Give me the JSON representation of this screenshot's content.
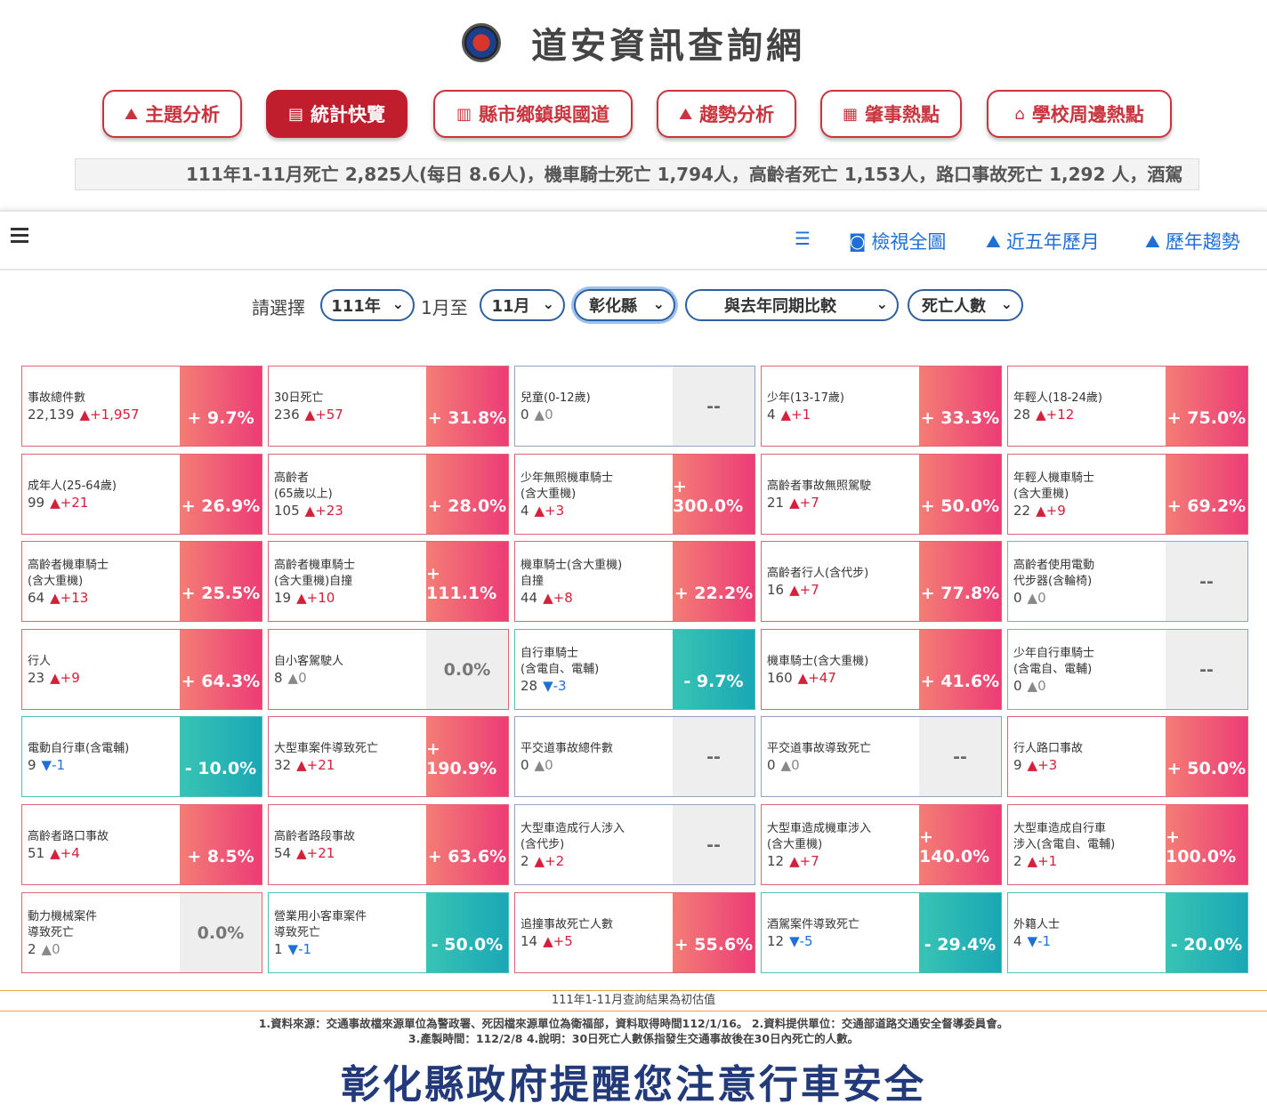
{
  "site": {
    "title": "道安資訊查詢網"
  },
  "nav": [
    {
      "label": "主題分析",
      "icon": "chart-area-icon",
      "glyph": "⛰",
      "active": false
    },
    {
      "label": "統計快覽",
      "icon": "newspaper-icon",
      "glyph": "▤",
      "active": true
    },
    {
      "label": "縣市鄉鎮與國道",
      "icon": "bar-chart-icon",
      "glyph": "▥",
      "active": false
    },
    {
      "label": "趨勢分析",
      "icon": "chart-area-icon",
      "glyph": "⛰",
      "active": false
    },
    {
      "label": "肇事熱點",
      "icon": "map-icon",
      "glyph": "▦",
      "active": false
    },
    {
      "label": "學校周邊熱點",
      "icon": "school-icon",
      "glyph": "⌂",
      "active": false
    }
  ],
  "ticker": "111年1-11月死亡 2,825人(每日 8.6人)，機車騎士死亡 1,794人，高齡者死亡 1,153人，路口事故死亡 1,292 人，酒駕",
  "toolbar": {
    "view_all": "檢視全圖",
    "five_year": "近五年歷月",
    "yearly_trend": "歷年趨勢"
  },
  "filters": {
    "prompt": "請選擇",
    "year": "111年",
    "from_label": "1月至",
    "month": "11月",
    "county": "彰化縣",
    "compare": "與去年同期比較",
    "metric": "死亡人數"
  },
  "cards": [
    {
      "label": "事故總件數",
      "value": "22,139",
      "arrow": "▲",
      "delta": "+1,957",
      "pct": "+ 9.7%",
      "state": "pos"
    },
    {
      "label": "30日死亡",
      "value": "236",
      "arrow": "▲",
      "delta": "+57",
      "pct": "+ 31.8%",
      "state": "pos"
    },
    {
      "label": "兒童(0-12歲)",
      "value": "0",
      "arrow": "▲",
      "delta": "0",
      "pct": "--",
      "state": "neu"
    },
    {
      "label": "少年(13-17歲)",
      "value": "4",
      "arrow": "▲",
      "delta": "+1",
      "pct": "+ 33.3%",
      "state": "pos"
    },
    {
      "label": "年輕人(18-24歲)",
      "value": "28",
      "arrow": "▲",
      "delta": "+12",
      "pct": "+ 75.0%",
      "state": "pos"
    },
    {
      "label": "成年人(25-64歲)",
      "value": "99",
      "arrow": "▲",
      "delta": "+21",
      "pct": "+ 26.9%",
      "state": "pos"
    },
    {
      "label": "高齡者\n(65歲以上)",
      "value": "105",
      "arrow": "▲",
      "delta": "+23",
      "pct": "+ 28.0%",
      "state": "pos"
    },
    {
      "label": "少年無照機車騎士\n(含大重機)",
      "value": "4",
      "arrow": "▲",
      "delta": "+3",
      "pct": "+ 300.0%",
      "state": "pos"
    },
    {
      "label": "高齡者事故無照駕駛",
      "value": "21",
      "arrow": "▲",
      "delta": "+7",
      "pct": "+ 50.0%",
      "state": "pos"
    },
    {
      "label": "年輕人機車騎士\n(含大重機)",
      "value": "22",
      "arrow": "▲",
      "delta": "+9",
      "pct": "+ 69.2%",
      "state": "pos"
    },
    {
      "label": "高齡者機車騎士\n(含大重機)",
      "value": "64",
      "arrow": "▲",
      "delta": "+13",
      "pct": "+ 25.5%",
      "state": "pos"
    },
    {
      "label": "高齡者機車騎士\n(含大重機)自撞",
      "value": "19",
      "arrow": "▲",
      "delta": "+10",
      "pct": "+ 111.1%",
      "state": "pos"
    },
    {
      "label": "機車騎士(含大重機)\n自撞",
      "value": "44",
      "arrow": "▲",
      "delta": "+8",
      "pct": "+ 22.2%",
      "state": "pos"
    },
    {
      "label": "高齡者行人(含代步)",
      "value": "16",
      "arrow": "▲",
      "delta": "+7",
      "pct": "+ 77.8%",
      "state": "pos"
    },
    {
      "label": "高齡者使用電動\n代步器(含輪椅)",
      "value": "0",
      "arrow": "▲",
      "delta": "0",
      "pct": "--",
      "state": "neu"
    },
    {
      "label": "行人",
      "value": "23",
      "arrow": "▲",
      "delta": "+9",
      "pct": "+ 64.3%",
      "state": "pos"
    },
    {
      "label": "自小客駕駛人",
      "value": "8",
      "arrow": "▲",
      "delta": "0",
      "pct": "0.0%",
      "state": "zero"
    },
    {
      "label": "自行車騎士\n(含電自、電輔)",
      "value": "28",
      "arrow": "▼",
      "delta": "-3",
      "pct": "- 9.7%",
      "state": "neg"
    },
    {
      "label": "機車騎士(含大重機)",
      "value": "160",
      "arrow": "▲",
      "delta": "+47",
      "pct": "+ 41.6%",
      "state": "pos"
    },
    {
      "label": "少年自行車騎士\n(含電自、電輔)",
      "value": "0",
      "arrow": "▲",
      "delta": "0",
      "pct": "--",
      "state": "neu"
    },
    {
      "label": "電動自行車(含電輔)",
      "value": "9",
      "arrow": "▼",
      "delta": "-1",
      "pct": "- 10.0%",
      "state": "neg"
    },
    {
      "label": "大型車案件導致死亡",
      "value": "32",
      "arrow": "▲",
      "delta": "+21",
      "pct": "+ 190.9%",
      "state": "pos"
    },
    {
      "label": "平交道事故總件數",
      "value": "0",
      "arrow": "▲",
      "delta": "0",
      "pct": "--",
      "state": "neu"
    },
    {
      "label": "平交道事故導致死亡",
      "value": "0",
      "arrow": "▲",
      "delta": "0",
      "pct": "--",
      "state": "neu"
    },
    {
      "label": "行人路口事故",
      "value": "9",
      "arrow": "▲",
      "delta": "+3",
      "pct": "+ 50.0%",
      "state": "pos"
    },
    {
      "label": "高齡者路口事故",
      "value": "51",
      "arrow": "▲",
      "delta": "+4",
      "pct": "+ 8.5%",
      "state": "pos"
    },
    {
      "label": "高齡者路段事故",
      "value": "54",
      "arrow": "▲",
      "delta": "+21",
      "pct": "+ 63.6%",
      "state": "pos"
    },
    {
      "label": "大型車造成行人涉入\n(含代步)",
      "value": "2",
      "arrow": "▲",
      "delta": "+2",
      "pct": "--",
      "state": "neu"
    },
    {
      "label": "大型車造成機車涉入\n(含大重機)",
      "value": "12",
      "arrow": "▲",
      "delta": "+7",
      "pct": "+ 140.0%",
      "state": "pos"
    },
    {
      "label": "大型車造成自行車\n涉入(含電自、電輔)",
      "value": "2",
      "arrow": "▲",
      "delta": "+1",
      "pct": "+ 100.0%",
      "state": "pos"
    },
    {
      "label": "動力機械案件\n導致死亡",
      "value": "2",
      "arrow": "▲",
      "delta": "0",
      "pct": "0.0%",
      "state": "zero"
    },
    {
      "label": "營業用小客車案件\n導致死亡",
      "value": "1",
      "arrow": "▼",
      "delta": "-1",
      "pct": "- 50.0%",
      "state": "neg"
    },
    {
      "label": "追撞事故死亡人數",
      "value": "14",
      "arrow": "▲",
      "delta": "+5",
      "pct": "+ 55.6%",
      "state": "pos"
    },
    {
      "label": "酒駕案件導致死亡",
      "value": "12",
      "arrow": "▼",
      "delta": "-5",
      "pct": "- 29.4%",
      "state": "neg"
    },
    {
      "label": "外籍人士",
      "value": "4",
      "arrow": "▼",
      "delta": "-1",
      "pct": "- 20.0%",
      "state": "neg"
    }
  ],
  "footer": {
    "estimate_note": "111年1-11月查詢結果為初估值",
    "note_line1": "1.資料來源：交通事故檔來源單位為警政署、死因檔來源單位為衛福部，資料取得時間112/1/16。 2.資料提供單位：交通部道路交通安全督導委員會。",
    "note_line2": "3.產製時間：112/2/8 4.說明：30日死亡人數係指發生交通事故後在30日內死亡的人數。",
    "slogan": "彰化縣政府提醒您注意行車安全"
  }
}
